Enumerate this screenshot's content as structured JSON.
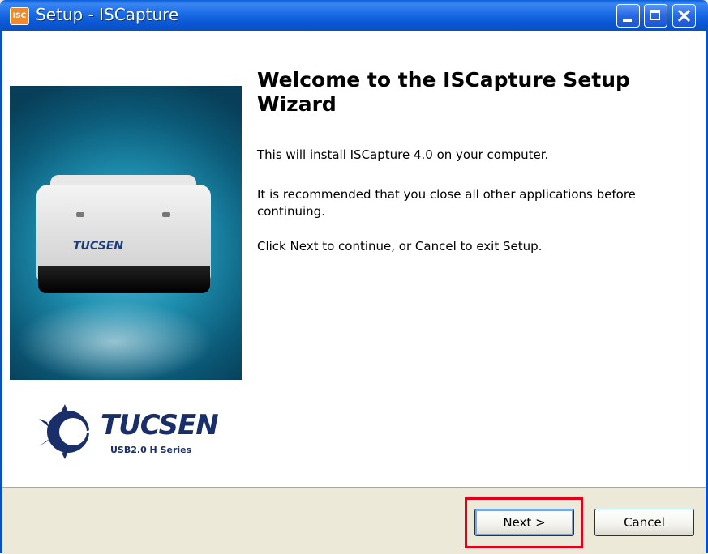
{
  "window": {
    "title": "Setup - ISCapture",
    "app_icon": "isc-app-icon",
    "buttons": {
      "minimize": "minimize-icon",
      "maximize": "maximize-icon",
      "close": "close-icon"
    }
  },
  "sidebar": {
    "brand_name": "TUCSEN",
    "brand_sub": "USB2.0  H Series",
    "camera_logo": "TUCSEN"
  },
  "main": {
    "heading": "Welcome to the ISCapture Setup Wizard",
    "para1": "This will install ISCapture 4.0 on your computer.",
    "para2": "It is recommended that you close all other applications before continuing.",
    "para3": "Click Next to continue, or Cancel to exit Setup."
  },
  "footer": {
    "next_label": "Next >",
    "cancel_label": "Cancel"
  },
  "colors": {
    "titlebar": "#0a5fd7",
    "highlight": "#e0001a",
    "dialog_bg": "#ece9d8"
  }
}
